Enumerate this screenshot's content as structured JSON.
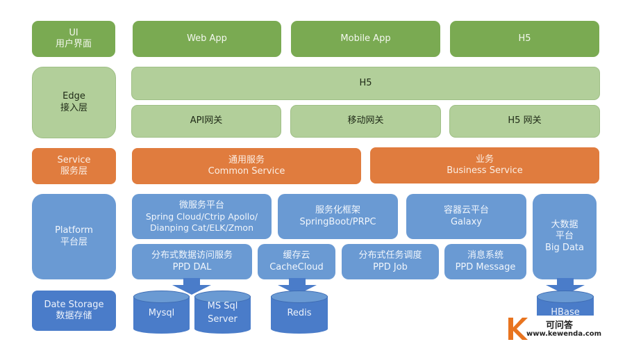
{
  "colors": {
    "ui_green": "#7aaa52",
    "edge_green": "#b2cf9a",
    "service_orange": "#e07c3e",
    "platform_blue": "#6a9ad3",
    "storage_blue": "#4a7cc9",
    "watermark_orange": "#e8741f"
  },
  "layers": {
    "ui": {
      "en": "UI",
      "zh": "用户界面"
    },
    "edge": {
      "en": "Edge",
      "zh": "接入层"
    },
    "service": {
      "en": "Service",
      "zh": "服务层"
    },
    "platform": {
      "en": "Platform",
      "zh": "平台层"
    },
    "storage": {
      "en": "Date Storage",
      "zh": "数据存储"
    }
  },
  "ui_items": [
    "Web App",
    "Mobile App",
    "H5"
  ],
  "edge_items": {
    "top": "H5",
    "gateways": [
      "API网关",
      "移动网关",
      "H5 网关"
    ]
  },
  "service_items": [
    {
      "zh": "通用服务",
      "en": "Common Service"
    },
    {
      "zh": "业务",
      "en": "Business Service"
    }
  ],
  "platform_items": {
    "microservice": {
      "zh": "微服务平台",
      "en1": "Spring Cloud/Ctrip Apollo/",
      "en2": "Dianping Cat/ELK/Zmon"
    },
    "framework": {
      "zh": "服务化框架",
      "en": "SpringBoot/PRPC"
    },
    "container": {
      "zh": "容器云平台",
      "en": "Galaxy"
    },
    "bigdata": {
      "zh1": "大数据",
      "zh2": "平台",
      "en": "Big Data"
    },
    "dal": {
      "zh": "分布式数据访问服务",
      "en": "PPD DAL"
    },
    "cache": {
      "zh": "缓存云",
      "en": "CacheCloud"
    },
    "job": {
      "zh": "分布式任务调度",
      "en": "PPD Job"
    },
    "message": {
      "zh": "消息系统",
      "en": "PPD Message"
    }
  },
  "storage_items": {
    "mysql": "Mysql",
    "mssql1": "MS Sql",
    "mssql2": "Server",
    "redis": "Redis",
    "hbase": "HBase"
  },
  "watermark": {
    "letter": "K",
    "name": "可问答",
    "url": "www.kewenda.com"
  }
}
